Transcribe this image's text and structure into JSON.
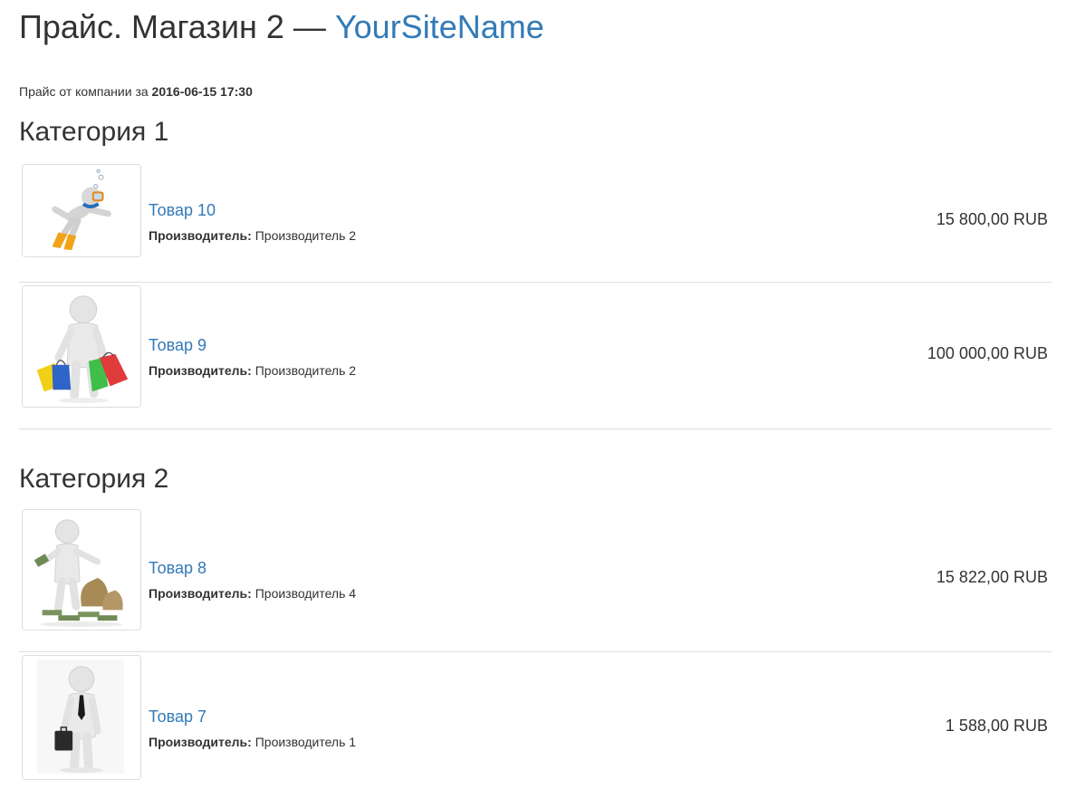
{
  "header": {
    "title": "Прайс. Магазин 2 — ",
    "site_name": "YourSiteName"
  },
  "meta": {
    "intro": "Прайс от компании за",
    "date": "2016-06-15 17:30"
  },
  "categories": [
    {
      "title": "Категория 1",
      "products": [
        {
          "name": "Товар 10",
          "maker_label": "Производитель:",
          "maker": "Производитель 2",
          "price": "15 800,00 RUB",
          "image": "diver-figure-icon"
        },
        {
          "name": "Товар 9",
          "maker_label": "Производитель:",
          "maker": "Производитель 2",
          "price": "100 000,00 RUB",
          "image": "shopping-figure-icon"
        }
      ]
    },
    {
      "title": "Категория 2",
      "products": [
        {
          "name": "Товар 8",
          "maker_label": "Производитель:",
          "maker": "Производитель 4",
          "price": "15 822,00 RUB",
          "image": "money-bags-figure-icon"
        },
        {
          "name": "Товар 7",
          "maker_label": "Производитель:",
          "maker": "Производитель 1",
          "price": "1 588,00 RUB",
          "image": "businessman-figure-icon"
        }
      ]
    }
  ]
}
